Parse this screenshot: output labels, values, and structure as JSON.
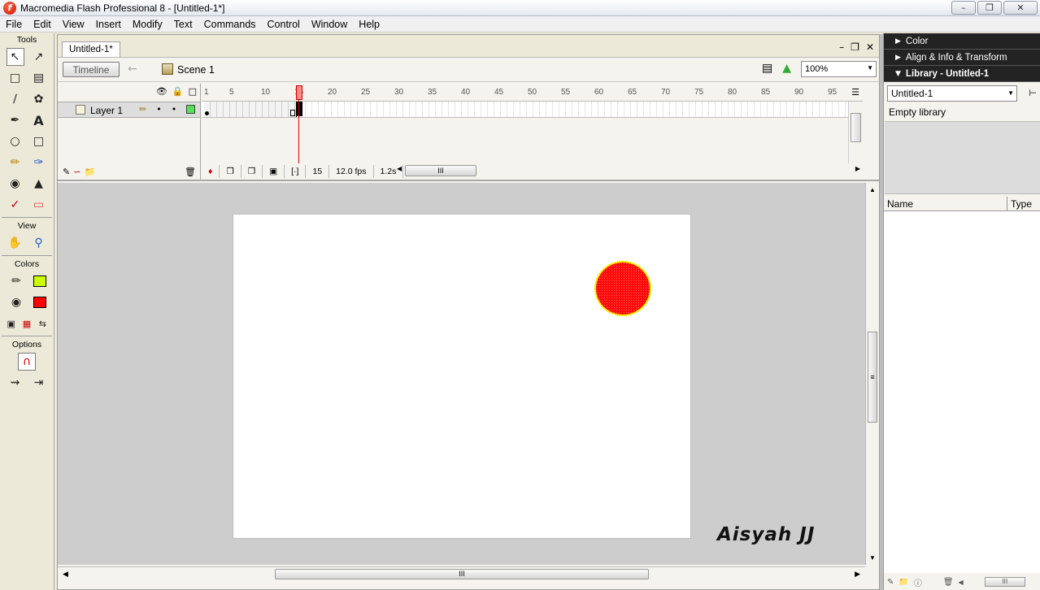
{
  "window": {
    "title": "Macromedia Flash Professional 8 - [Untitled-1*]",
    "app_icon_glyph": "f"
  },
  "menu": [
    "File",
    "Edit",
    "View",
    "Insert",
    "Modify",
    "Text",
    "Commands",
    "Control",
    "Window",
    "Help"
  ],
  "tools": {
    "header": "Tools",
    "view_header": "View",
    "colors_header": "Colors",
    "options_header": "Options",
    "stroke_color": "#ccff00",
    "fill_color": "#ff0000"
  },
  "document": {
    "tab": "Untitled-1*",
    "timeline_button": "Timeline",
    "scene": "Scene 1",
    "zoom": "100%"
  },
  "timeline": {
    "layer_name": "Layer 1",
    "ruler": [
      "1",
      "5",
      "10",
      "15",
      "20",
      "25",
      "30",
      "35",
      "40",
      "45",
      "50",
      "55",
      "60",
      "65",
      "70",
      "75",
      "80",
      "85",
      "90",
      "95"
    ],
    "current_frame": "15",
    "fps": "12.0 fps",
    "elapsed": "1.2s"
  },
  "stage": {
    "watermark": "Aisyah JJ",
    "ball_fill": "#ff0b0b",
    "ball_stroke": "#f4f000"
  },
  "panels": {
    "color": "Color",
    "align": "Align & Info & Transform",
    "library": "Library - Untitled-1",
    "library_select": "Untitled-1",
    "empty": "Empty library",
    "col_name": "Name",
    "col_type": "Type"
  }
}
